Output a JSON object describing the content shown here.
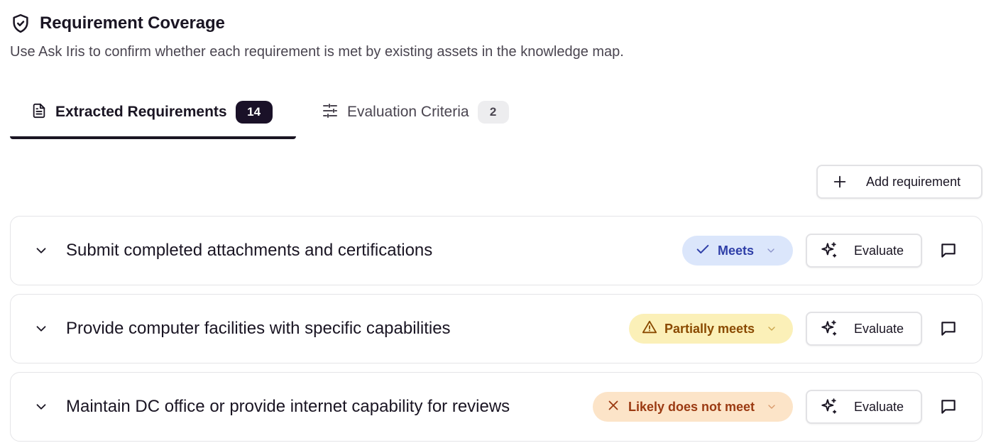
{
  "header": {
    "title": "Requirement Coverage",
    "subtitle": "Use Ask Iris to confirm whether each requirement is met by existing assets in the knowledge map.",
    "icon": "shield-check-icon"
  },
  "tabs": [
    {
      "label": "Extracted Requirements",
      "count": "14",
      "icon": "document-icon",
      "active": true
    },
    {
      "label": "Evaluation Criteria",
      "count": "2",
      "icon": "sliders-icon",
      "active": false
    }
  ],
  "add_button": {
    "label": "Add requirement",
    "icon": "plus-icon"
  },
  "requirements": [
    {
      "title": "Submit completed attachments and certifications",
      "status": "Meets",
      "status_icon": "check-icon",
      "evaluate_label": "Evaluate"
    },
    {
      "title": "Provide computer facilities with specific capabilities",
      "status": "Partially meets",
      "status_icon": "warning-icon",
      "evaluate_label": "Evaluate"
    },
    {
      "title": "Maintain DC office or provide internet capability for reviews",
      "status": "Likely does not meet",
      "status_icon": "x-icon",
      "evaluate_label": "Evaluate"
    }
  ],
  "colors": {
    "meets_bg": "#dbe6fb",
    "meets_fg": "#2f3fa8",
    "partial_bg": "#fbf0b8",
    "partial_fg": "#8a4a00",
    "not_bg": "#fce4c8",
    "not_fg": "#9b3a12",
    "active_count_bg": "#1a1128"
  }
}
